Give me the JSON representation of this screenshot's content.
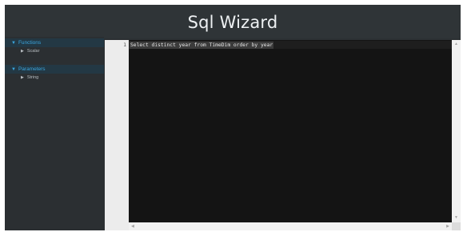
{
  "app": {
    "title": "Sql Wizard"
  },
  "sidebar": {
    "sections": [
      {
        "label": "Functions",
        "items": [
          {
            "label": "Scalar"
          }
        ]
      },
      {
        "label": "Parameters",
        "items": [
          {
            "label": "String"
          }
        ]
      }
    ]
  },
  "editor": {
    "line_numbers": [
      "1"
    ],
    "lines": [
      "Select distinct year from TimeDim order by year"
    ]
  },
  "icons": {
    "caret_expanded": "▼",
    "caret_collapsed": "▶",
    "scroll_up": "▲",
    "scroll_down": "▼",
    "scroll_left": "◀",
    "scroll_right": "▶"
  },
  "colors": {
    "accent": "#3aa6df",
    "background": "#2c3033",
    "editor_bg": "#141414"
  }
}
